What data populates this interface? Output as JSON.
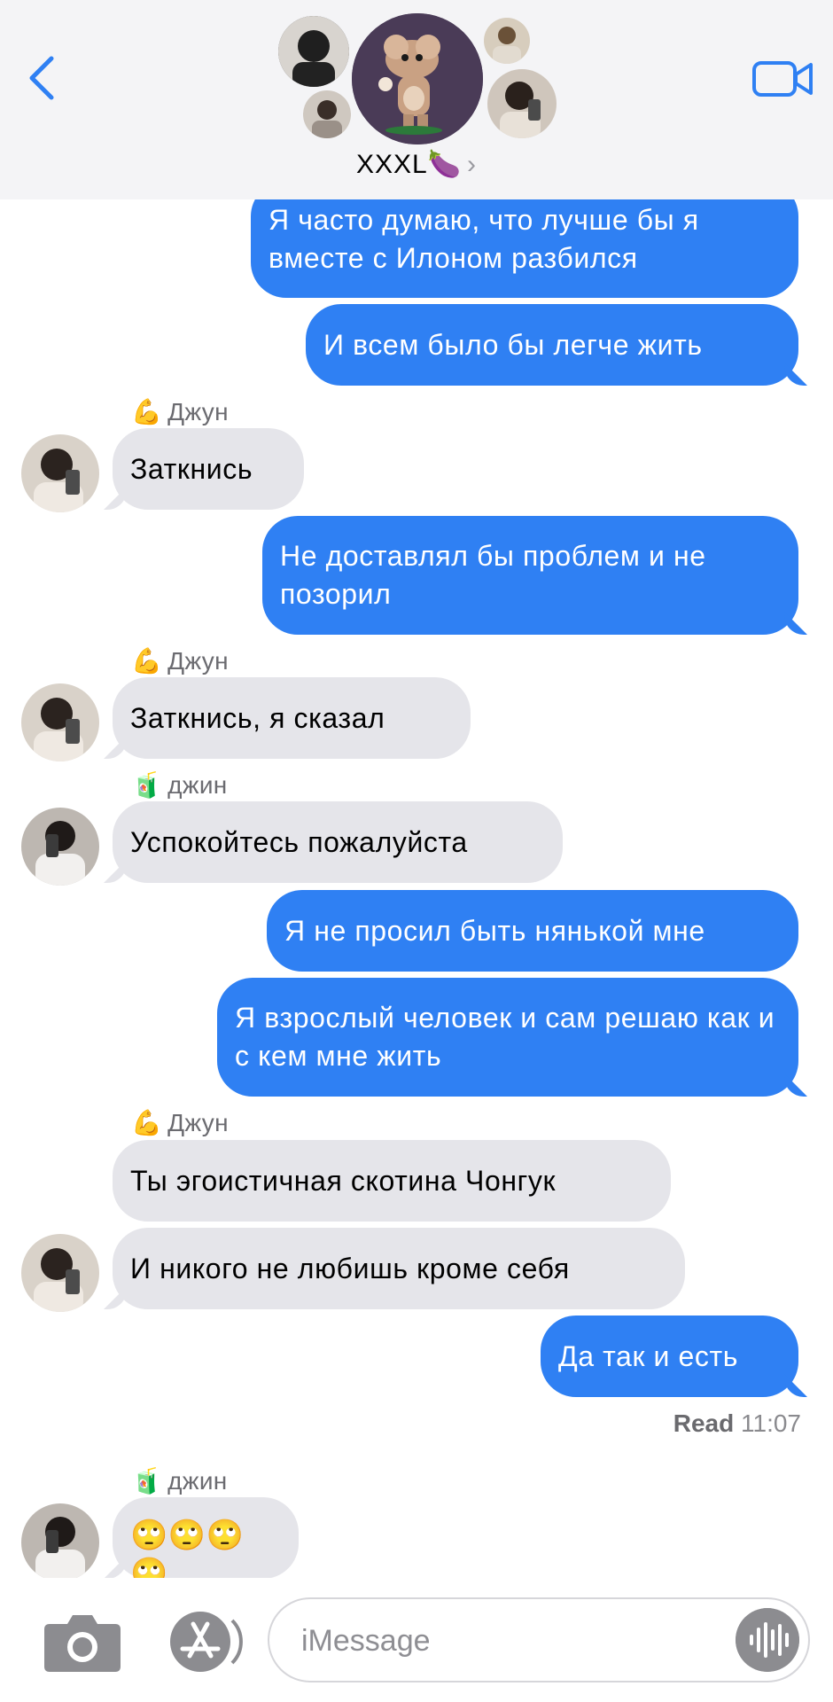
{
  "header": {
    "group_name": "XXXL🍆",
    "chevron": "›",
    "back_icon": "chevron-left-icon",
    "video_icon": "video-camera-icon",
    "accent": "#2f80f3"
  },
  "messages": [
    {
      "text": "Я часто думаю,  что лучше бы я вместе с Илоном разбился"
    },
    {
      "text": "И всем было бы легче жить"
    },
    {
      "sender": "Джун",
      "sender_emoji": "💪",
      "text": "Заткнись"
    },
    {
      "text": "Не доставлял бы проблем и не позорил"
    },
    {
      "sender": "Джун",
      "sender_emoji": "💪",
      "text": "Заткнись,  я сказал"
    },
    {
      "sender": "джин",
      "sender_emoji": "🧃",
      "text": "Успокойтесь пожалуйста"
    },
    {
      "text": "Я не просил быть нянькой мне"
    },
    {
      "text": "Я взрослый человек и сам решаю как и с кем мне жить"
    },
    {
      "sender": "Джун",
      "sender_emoji": "💪",
      "text": "Ты эгоистичная скотина Чонгук"
    },
    {
      "text": "И никого не любишь кроме себя"
    },
    {
      "text": "Да так и есть"
    },
    {
      "sender": "джин",
      "sender_emoji": "🧃",
      "text": "🙄🙄🙄🙄"
    }
  ],
  "read_receipt": {
    "label": "Read",
    "time": "11:07"
  },
  "composer": {
    "placeholder": "iMessage",
    "camera_icon": "camera-icon",
    "apps_icon": "app-store-icon",
    "audio_icon": "waveform-icon"
  }
}
